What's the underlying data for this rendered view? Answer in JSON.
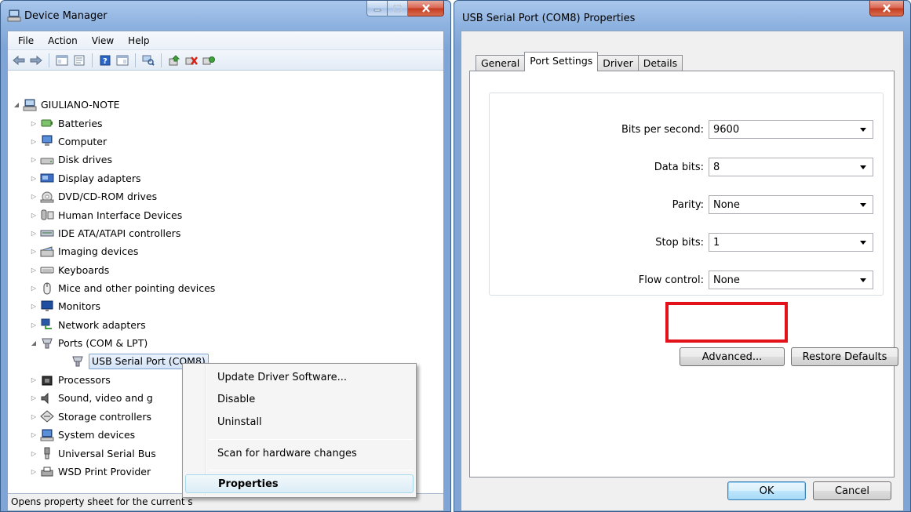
{
  "device_manager": {
    "title": "Device Manager",
    "menu": [
      "File",
      "Action",
      "View",
      "Help"
    ],
    "toolbar_icons": [
      "back-icon",
      "forward-icon",
      "show-hide-console-tree-icon",
      "properties-icon",
      "help-icon",
      "action-pane-icon",
      "scan-hardware-icon",
      "update-driver-icon",
      "uninstall-icon",
      "enable-icon"
    ],
    "tree": {
      "root": "GIULIANO-NOTE",
      "categories": [
        {
          "label": "Batteries",
          "icon": "battery-icon"
        },
        {
          "label": "Computer",
          "icon": "computer-icon"
        },
        {
          "label": "Disk drives",
          "icon": "disk-drive-icon"
        },
        {
          "label": "Display adapters",
          "icon": "display-adapter-icon"
        },
        {
          "label": "DVD/CD-ROM drives",
          "icon": "dvd-drive-icon"
        },
        {
          "label": "Human Interface Devices",
          "icon": "hid-icon"
        },
        {
          "label": "IDE ATA/ATAPI controllers",
          "icon": "ide-controller-icon"
        },
        {
          "label": "Imaging devices",
          "icon": "imaging-device-icon"
        },
        {
          "label": "Keyboards",
          "icon": "keyboard-icon"
        },
        {
          "label": "Mice and other pointing devices",
          "icon": "mouse-icon"
        },
        {
          "label": "Monitors",
          "icon": "monitor-icon"
        },
        {
          "label": "Network adapters",
          "icon": "network-adapter-icon"
        },
        {
          "label": "Ports (COM & LPT)",
          "icon": "port-icon"
        },
        {
          "label": "USB Serial Port (COM8)",
          "icon": "port-icon"
        },
        {
          "label": "Processors",
          "icon": "processor-icon"
        },
        {
          "label": "Sound, video and g",
          "icon": "sound-icon"
        },
        {
          "label": "Storage controllers",
          "icon": "storage-controller-icon"
        },
        {
          "label": "System devices",
          "icon": "system-device-icon"
        },
        {
          "label": "Universal Serial Bus",
          "icon": "usb-icon"
        },
        {
          "label": "WSD Print Provider",
          "icon": "printer-icon"
        }
      ]
    },
    "status_text": "Opens property sheet for the current s"
  },
  "context_menu": {
    "items": [
      "Update Driver Software...",
      "Disable",
      "Uninstall",
      "Scan for hardware changes",
      "Properties"
    ]
  },
  "properties_dialog": {
    "title": "USB Serial Port (COM8) Properties",
    "tabs": [
      "General",
      "Port Settings",
      "Driver",
      "Details"
    ],
    "active_tab": "Port Settings",
    "fields": [
      {
        "label": "Bits per second:",
        "value": "9600"
      },
      {
        "label": "Data bits:",
        "value": "8"
      },
      {
        "label": "Parity:",
        "value": "None"
      },
      {
        "label": "Stop bits:",
        "value": "1"
      },
      {
        "label": "Flow control:",
        "value": "None"
      }
    ],
    "buttons": {
      "advanced": "Advanced...",
      "restore_defaults": "Restore Defaults",
      "ok": "OK",
      "cancel": "Cancel"
    },
    "highlight_color": "#e3121a"
  }
}
